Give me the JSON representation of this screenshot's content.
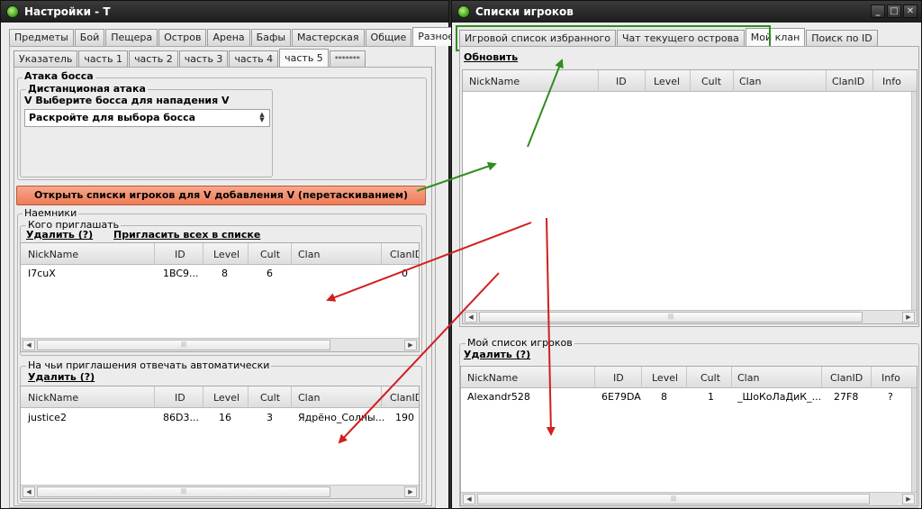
{
  "left_window": {
    "title": "Настройки - T",
    "main_tabs": [
      "Предметы",
      "Бой",
      "Пещера",
      "Остров",
      "Арена",
      "Бафы",
      "Мастерская",
      "Общие",
      "Разное"
    ],
    "sub_tabs": [
      "Указатель",
      "часть 1",
      "часть 2",
      "часть 3",
      "часть 4",
      "часть 5",
      "*******"
    ],
    "boss_group_label": "Атака босса",
    "ranged_group_label": "Дистанционая атака",
    "boss_prompt": "V Выберите босса для нападения V",
    "boss_combo_value": "Раскройте для выбора босса",
    "open_lists_button": "Открыть списки игроков для V добавления V (перетаскиванием)",
    "mercs_label": "Наемники",
    "invite_group": {
      "label": "Кого приглашать",
      "delete_link": "Удалить (?)",
      "invite_all_link": "Пригласить всех в списке",
      "columns": [
        "NickName",
        "ID",
        "Level",
        "Cult",
        "Clan",
        "ClanID"
      ],
      "rows": [
        [
          "I7cuX",
          "1BC9...",
          "8",
          "6",
          "",
          "0"
        ]
      ]
    },
    "auto_group": {
      "label": "На чьи приглашения отвечать автоматически",
      "delete_link": "Удалить (?)",
      "columns": [
        "NickName",
        "ID",
        "Level",
        "Cult",
        "Clan",
        "ClanID"
      ],
      "rows": [
        [
          "justice2",
          "86D3...",
          "16",
          "3",
          "Ядрёно_Солны...",
          "190"
        ]
      ]
    }
  },
  "right_window": {
    "title": "Списки игроков",
    "tabs": [
      "Игровой список избранного",
      "Чат текущего острова",
      "Мой клан",
      "Поиск по ID"
    ],
    "refresh_link": "Обновить",
    "clan_table_columns": [
      "NickName",
      "ID",
      "Level",
      "Cult",
      "Clan",
      "ClanID",
      "Info"
    ],
    "my_list": {
      "label": "Мой список игроков",
      "delete_link": "Удалить (?)",
      "columns": [
        "NickName",
        "ID",
        "Level",
        "Cult",
        "Clan",
        "ClanID",
        "Info"
      ],
      "rows": [
        [
          "Alexandr528",
          "6E79DA",
          "8",
          "1",
          "_ШоКоЛаДиК_...",
          "27F8",
          "?"
        ]
      ]
    }
  },
  "colors": {
    "annotation_red": "#d21e1e",
    "annotation_green": "#2f8d1f",
    "button_orange": "#ee7b57"
  },
  "icons": [
    "app-icon",
    "minimize-icon",
    "maximize-icon",
    "close-icon"
  ]
}
